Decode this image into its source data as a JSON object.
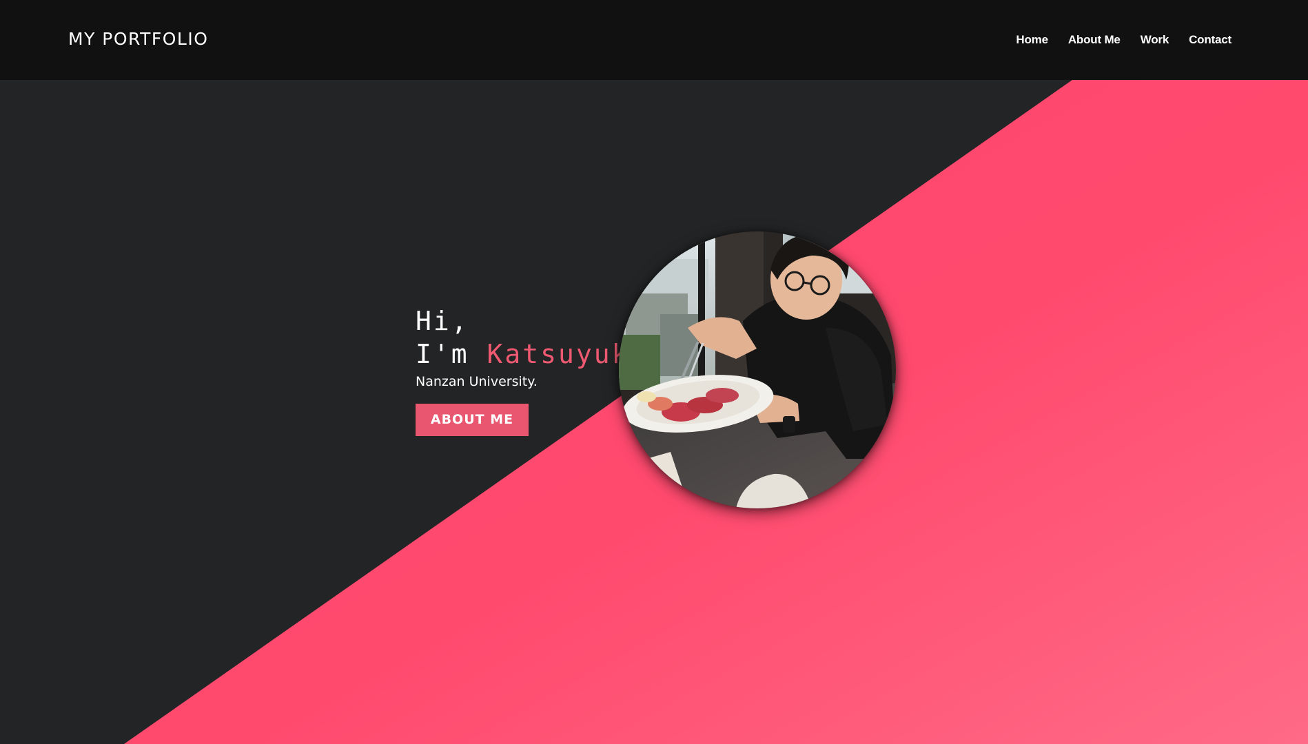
{
  "header": {
    "brand": "MY PORTFOLIO",
    "nav": [
      {
        "label": "Home"
      },
      {
        "label": "About Me"
      },
      {
        "label": "Work"
      },
      {
        "label": "Contact"
      }
    ]
  },
  "hero": {
    "greeting": "Hi,",
    "name_prefix": "I'm",
    "name": "Katsuyuki",
    "subtitle": "Nanzan University.",
    "button_label": "ABOUT ME"
  },
  "colors": {
    "header_bg": "#111111",
    "page_bg": "#232425",
    "accent_pink": "#ff4a6e",
    "name_pink": "#ef5a72",
    "button_pink": "#e85670"
  }
}
